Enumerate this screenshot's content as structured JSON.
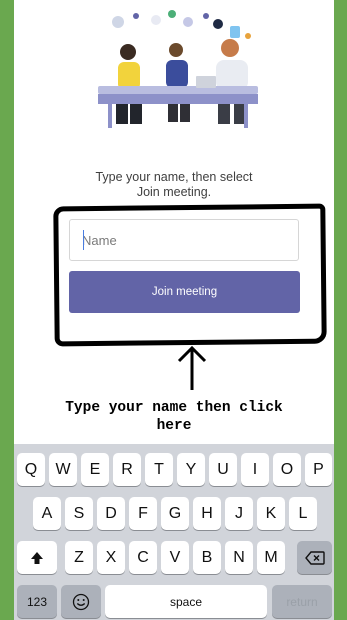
{
  "prompt": {
    "line1": "Type your name, then select",
    "line2": "Join meeting."
  },
  "name_input": {
    "placeholder": "Name",
    "value": ""
  },
  "join_button": {
    "label": "Join meeting"
  },
  "annotation": {
    "line1": "Type your name then click",
    "line2": "here"
  },
  "keyboard": {
    "row1": [
      "Q",
      "W",
      "E",
      "R",
      "T",
      "Y",
      "U",
      "I",
      "O",
      "P"
    ],
    "row2": [
      "A",
      "S",
      "D",
      "F",
      "G",
      "H",
      "J",
      "K",
      "L"
    ],
    "row3": [
      "Z",
      "X",
      "C",
      "V",
      "B",
      "N",
      "M"
    ],
    "numbers_key": "123",
    "space_key": "space",
    "return_key": "return"
  },
  "colors": {
    "accent": "#6264a7",
    "border": "#6aa84f",
    "keyboard_bg": "#d1d4da"
  },
  "icons": [
    "meeting-illustration",
    "up-arrow-icon",
    "shift-icon",
    "backspace-icon",
    "emoji-icon"
  ]
}
